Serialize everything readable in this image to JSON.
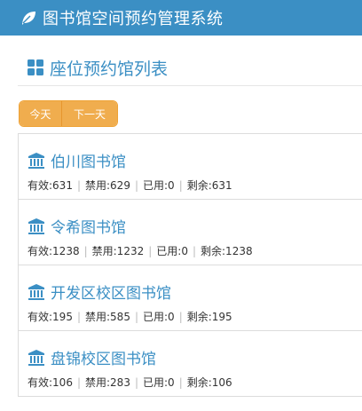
{
  "header": {
    "title": "图书馆空间预约管理系统",
    "icon": "leaf-icon"
  },
  "section": {
    "title": "座位预约馆列表",
    "icon": "grid-icon"
  },
  "day_buttons": {
    "today": "今天",
    "tomorrow": "下一天"
  },
  "colors": {
    "primary": "#3b8fc4",
    "warning": "#f0ad4e"
  },
  "libraries": [
    {
      "name": "伯川图书馆",
      "stats": {
        "valid": "有效:631",
        "disabled": "禁用:629",
        "used": "已用:0",
        "remaining": "剩余:631"
      }
    },
    {
      "name": "令希图书馆",
      "stats": {
        "valid": "有效:1238",
        "disabled": "禁用:1232",
        "used": "已用:0",
        "remaining": "剩余:1238"
      }
    },
    {
      "name": "开发区校区图书馆",
      "stats": {
        "valid": "有效:195",
        "disabled": "禁用:585",
        "used": "已用:0",
        "remaining": "剩余:195"
      }
    },
    {
      "name": "盘锦校区图书馆",
      "stats": {
        "valid": "有效:106",
        "disabled": "禁用:283",
        "used": "已用:0",
        "remaining": "剩余:106"
      }
    }
  ]
}
